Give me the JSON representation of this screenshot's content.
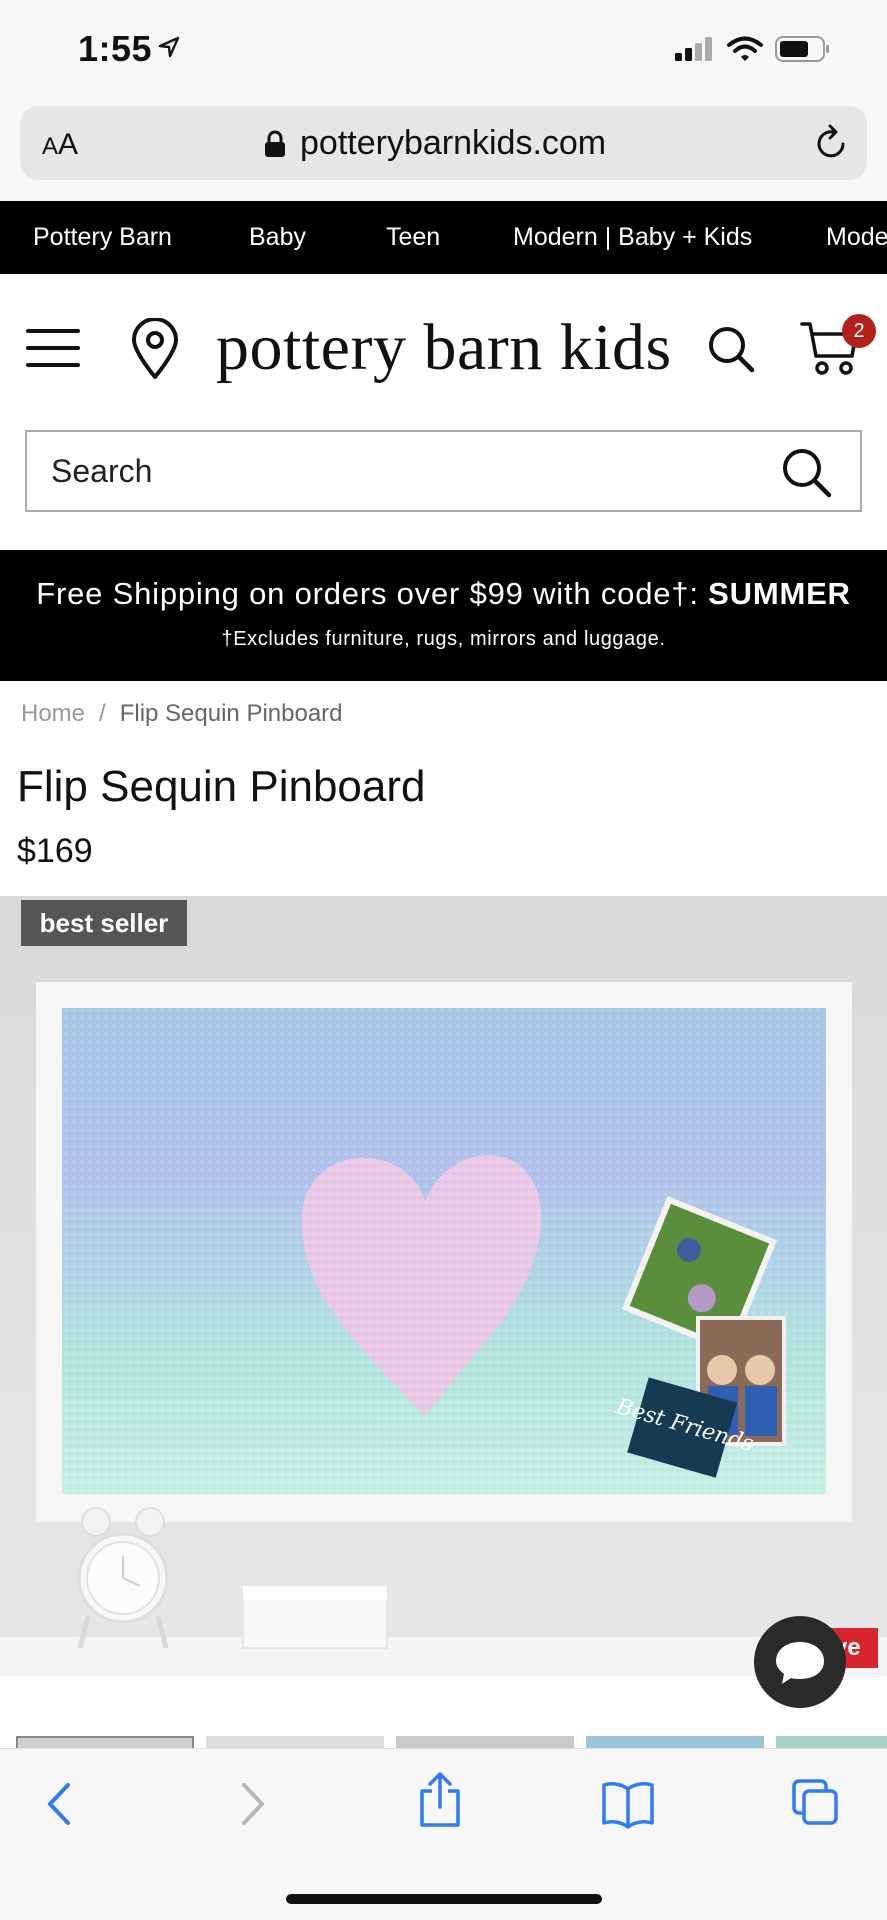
{
  "status": {
    "time": "1:55"
  },
  "browser": {
    "text_size_label_small": "A",
    "text_size_label_large": "A",
    "url": "potterybarnkids.com"
  },
  "brand_nav": {
    "items": [
      "Pottery Barn",
      "Baby",
      "Teen",
      "Modern | Baby + Kids",
      "Mode"
    ]
  },
  "header": {
    "logo": "pottery barn kids",
    "cart_count": "2"
  },
  "search": {
    "placeholder": "Search"
  },
  "promo": {
    "line1_text": "Free Shipping on orders over $99 with code†: ",
    "line1_code": "SUMMER",
    "line2": "†Excludes furniture, rugs, mirrors and luggage."
  },
  "breadcrumb": {
    "home": "Home",
    "separator": "/",
    "current": "Flip Sequin Pinboard"
  },
  "product": {
    "title": "Flip Sequin Pinboard",
    "price": "$169",
    "badge": "best seller",
    "photo_caption": "Best Friends",
    "live_label": "ve"
  },
  "colors": {
    "accent_red": "#b3211b",
    "safari_blue": "#2f7bf5",
    "banner_bg": "#000000"
  },
  "icons": [
    "location-arrow-icon",
    "signal-icon",
    "wifi-icon",
    "battery-icon",
    "lock-icon",
    "reload-icon",
    "menu-icon",
    "store-locator-icon",
    "search-icon",
    "cart-icon",
    "chat-icon",
    "back-icon",
    "forward-icon",
    "share-icon",
    "bookmarks-icon",
    "tabs-icon"
  ]
}
